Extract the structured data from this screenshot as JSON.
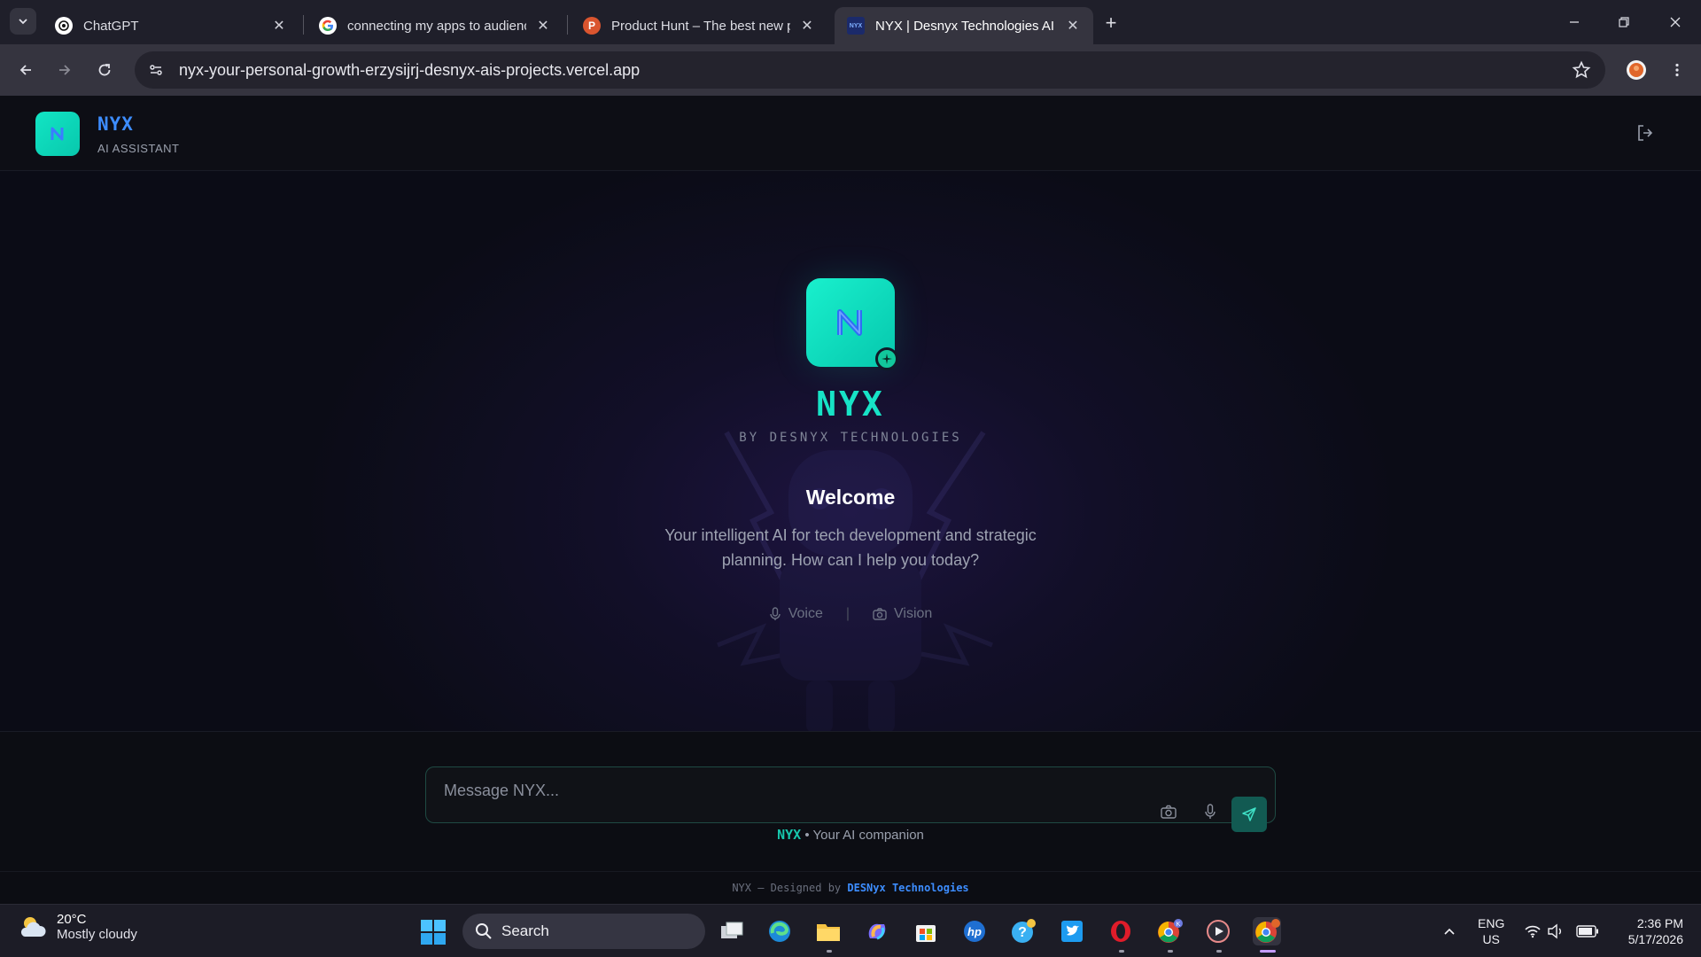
{
  "browser": {
    "tabs": [
      {
        "title": "ChatGPT",
        "active": false
      },
      {
        "title": "connecting my apps to audienc",
        "active": false
      },
      {
        "title": "Product Hunt – The best new pr",
        "active": false
      },
      {
        "title": "NYX | Desnyx Technologies AI",
        "active": true
      }
    ],
    "url": "nyx-your-personal-growth-erzysijrj-desnyx-ais-projects.vercel.app"
  },
  "header": {
    "brand": "NYX",
    "subtitle": "AI ASSISTANT"
  },
  "hero": {
    "title": "NYX",
    "byline": "BY DESNYX TECHNOLOGIES",
    "welcome": "Welcome",
    "description": "Your intelligent AI for tech development and strategic planning. How can I help you today?",
    "modes": {
      "voice": "Voice",
      "separator": "|",
      "vision": "Vision"
    }
  },
  "composer": {
    "placeholder": "Message NYX...",
    "companion_brand": "NYX",
    "companion_text": " • Your AI companion"
  },
  "footer": {
    "prefix": "NYX — Designed by ",
    "brand": "DESNyx Technologies"
  },
  "taskbar": {
    "weather_temp": "20°C",
    "weather_condition": "Mostly cloudy",
    "search_label": "Search",
    "lang_line1": "ENG",
    "lang_line2": "US",
    "time": "2:36 PM",
    "date": "5/17/2026"
  },
  "colors": {
    "accent_teal": "#17e3c6",
    "accent_blue": "#3d8dff",
    "background": "#0b0c16"
  }
}
